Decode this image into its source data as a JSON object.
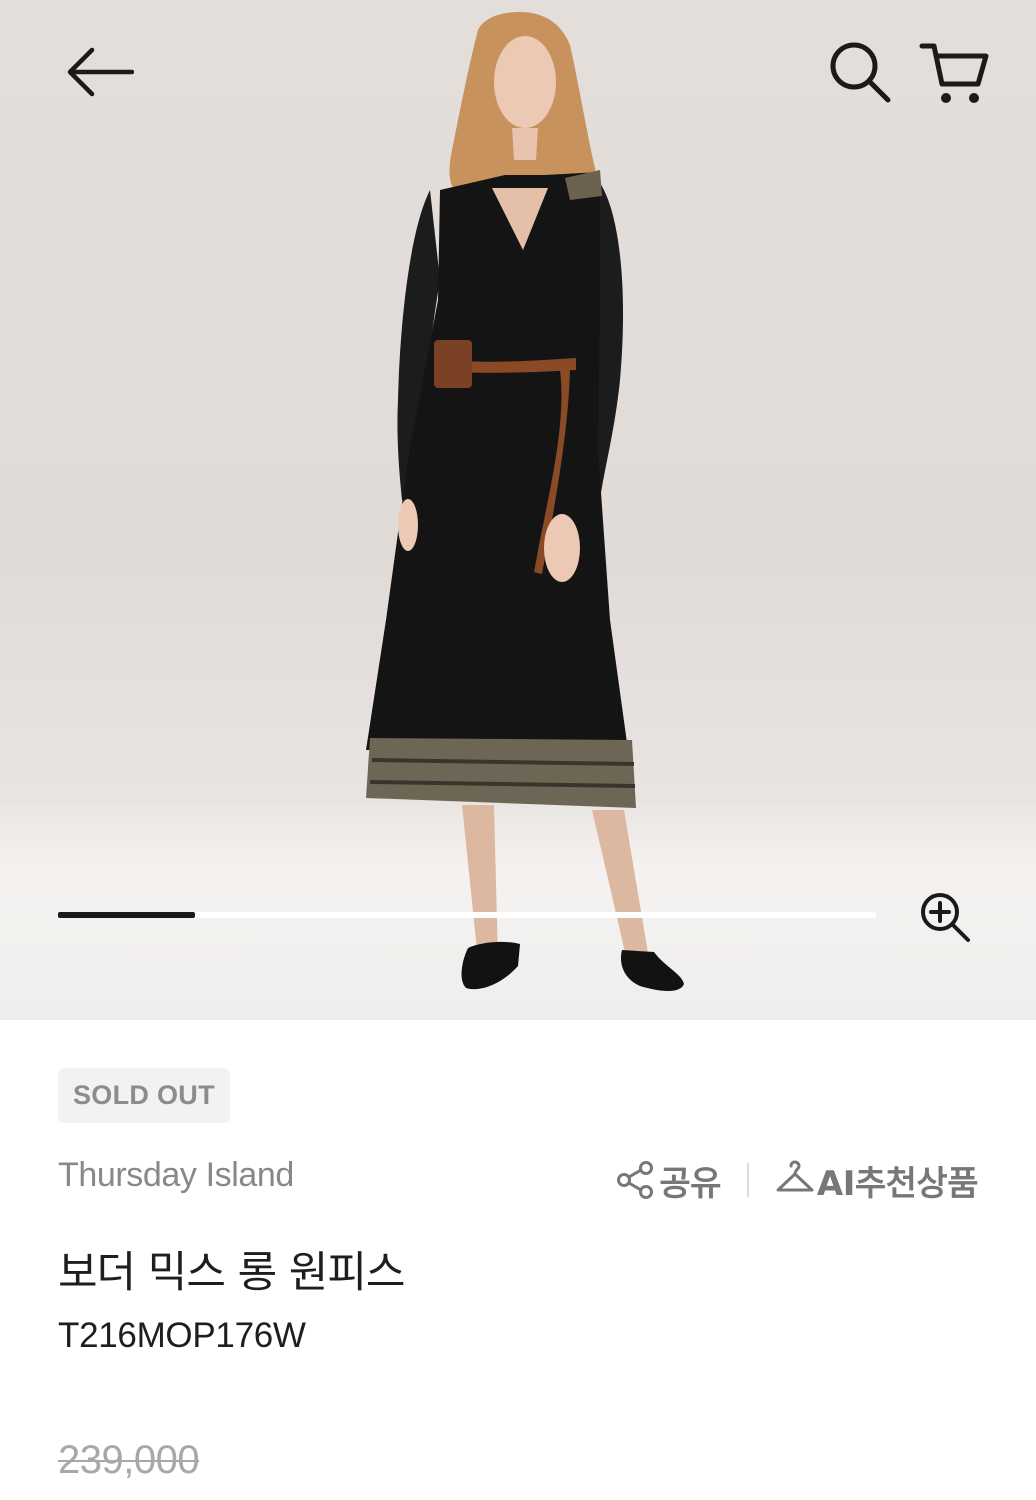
{
  "header": {
    "back_icon": "arrow-left-icon",
    "search_icon": "search-icon",
    "cart_icon": "cart-icon"
  },
  "gallery": {
    "image_description_icon": "product-photo",
    "progress": 0.167,
    "zoom_icon": "zoom-in-icon"
  },
  "product": {
    "status_badge": "SOLD OUT",
    "brand": "Thursday Island",
    "share_label": "공유",
    "ai_recommend_label": "AI추천상품",
    "name": "보더 믹스 롱 원피스",
    "code": "T216MOP176W",
    "original_price": "239,000"
  },
  "colors": {
    "accent": "#1a1a1a",
    "muted_text": "#888888",
    "badge_bg": "#f2f2f2"
  }
}
